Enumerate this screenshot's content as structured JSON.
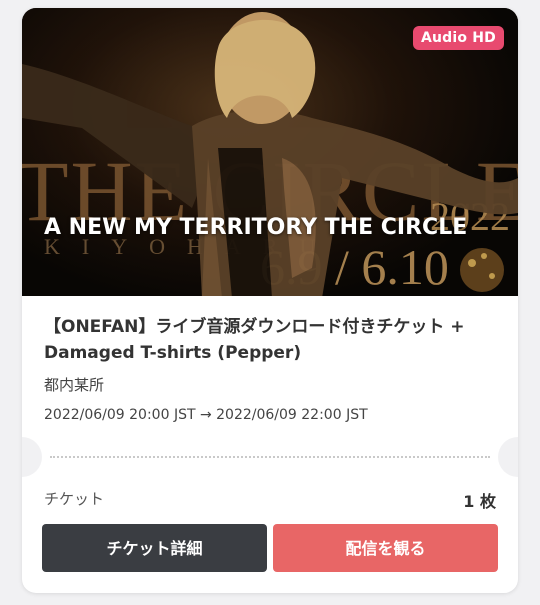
{
  "event": {
    "badge": "Audio HD",
    "hero_title": "A NEW MY TERRITORY THE CIRCLE",
    "name": "【ONEFAN】ライブ音源ダウンロード付きチケット + Damaged T-shirts (Pepper)",
    "venue": "都内某所",
    "datetime": "2022/06/09 20:00 JST → 2022/06/09 22:00 JST"
  },
  "poster_art": {
    "title_text": "THE CIRCLE",
    "year_text": "2022",
    "date_text": "6.9 / 6.10",
    "artist_text": "KIYOHARU"
  },
  "ticket": {
    "label": "チケット",
    "count": "1 枚"
  },
  "buttons": {
    "detail": "チケット詳細",
    "watch": "配信を観る"
  },
  "colors": {
    "badge": "#e84a6f",
    "detail_button": "#3a3d42",
    "watch_button": "#e86666",
    "background": "#f1f1f3"
  }
}
